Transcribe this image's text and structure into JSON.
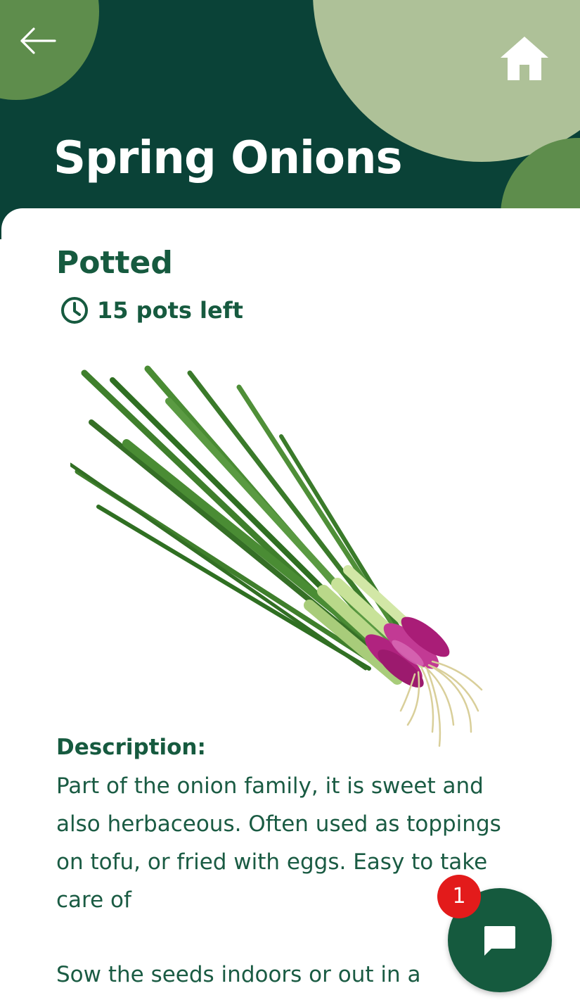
{
  "header": {
    "title": "Spring Onions",
    "back_icon": "arrow-left-icon",
    "home_icon": "home-icon"
  },
  "product": {
    "type": "Potted",
    "stock_icon": "clock-icon",
    "stock_text": "15 pots left",
    "image": "spring-onion-bunch"
  },
  "description": {
    "heading": "Description:",
    "text": "Part of the onion family, it is sweet and also herbaceous. Often used as toppings on tofu, or fried with eggs. Easy to take care of",
    "text2": "Sow the seeds indoors or out in a"
  },
  "chat": {
    "icon": "chat-bubble-icon",
    "badge_count": "1"
  },
  "colors": {
    "header_bg": "#0a4237",
    "accent_light": "#aec198",
    "accent_mid": "#5e8d4c",
    "text_green": "#165a3f",
    "badge_red": "#e31b1b"
  }
}
